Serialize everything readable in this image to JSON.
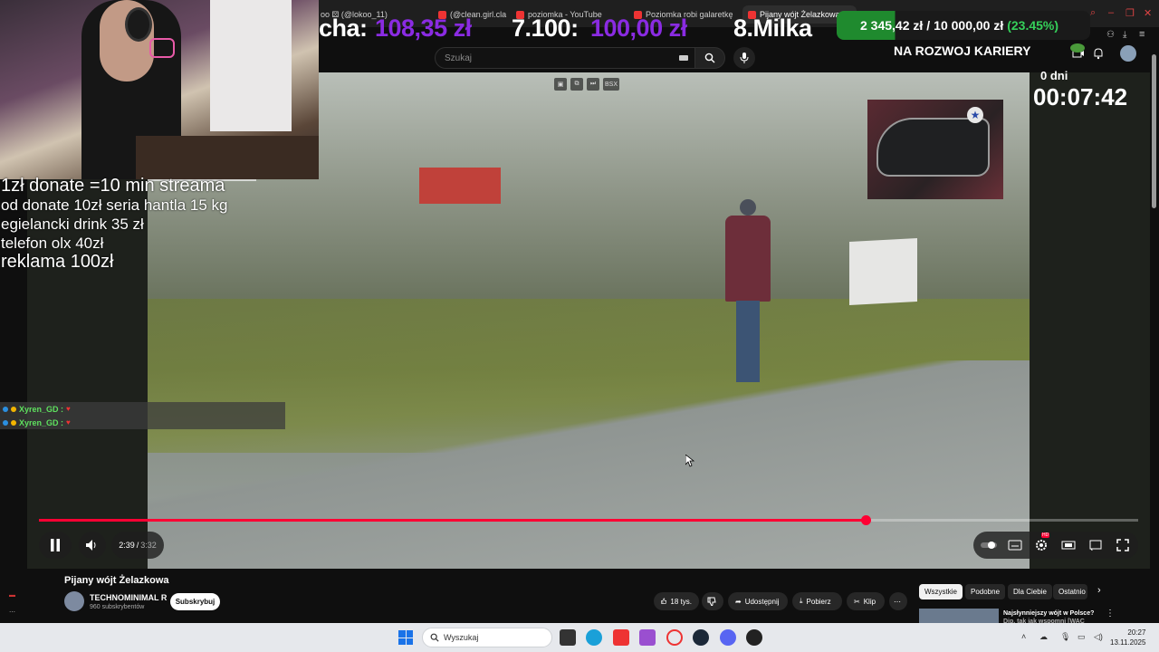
{
  "browser": {
    "tabs": [
      {
        "label": "oo ⚄ (@lokoo_11)"
      },
      {
        "label": "(@clean.girl.cla"
      },
      {
        "label": "poziomka - YouTube"
      },
      {
        "label": "Poziomka robi galaretkę"
      },
      {
        "label": "Pijany wójt Żelazkowa"
      }
    ],
    "new_tab": "+"
  },
  "overlay": {
    "cha_label": "cha:",
    "cha_value": "108,35 zł",
    "second_label": "7.100:",
    "second_value": "100,00 zł",
    "third_label": "8.Milka",
    "goal_current": "2 345,42 zł",
    "goal_separator": "/",
    "goal_target": "10 000,00 zł",
    "goal_percent": "(23.45%)",
    "goal_subtitle": "NA ROZWOJ KARIERY",
    "timer_days": "0 dni",
    "timer": "00:07:42"
  },
  "youtube": {
    "search_placeholder": "Szukaj",
    "video_title": "Pijany wójt Żelazkowa",
    "channel_name": "TECHNOMINIMAL R",
    "channel_subs": "960 subskrybentów",
    "subscribe_label": "Subskrybuj",
    "likes": "18 tys.",
    "share_label": "Udostępnij",
    "download_label": "Pobierz",
    "clip_label": "Klip",
    "time_current": "2:39",
    "time_sep": "/",
    "time_total": "3:32",
    "progress_fraction": 0.752,
    "chips": [
      "Wszystkie",
      "Podobne",
      "Dla Ciebie",
      "Ostatnio"
    ],
    "rec_title_line1": "Najsłynniejszy wójt w Polsce?",
    "rec_title_line2": "Dip, tak jak wspomni [WAC"
  },
  "stream": {
    "donate_lines": [
      "1zł donate =10 min streama",
      "od donate 10zł seria hantla 15 kg",
      "egielancki drink 35 zł",
      "telefon olx 40zł",
      "reklama 100zł"
    ],
    "chat": [
      {
        "user": "Xyren_GD :",
        "msg": "♥"
      },
      {
        "user": "Xyren_GD :",
        "msg": "♥"
      }
    ]
  },
  "taskbar": {
    "search_placeholder": "Wyszukaj",
    "time": "20:27",
    "date": "13.11.2025"
  },
  "colors": {
    "accent": "#ff0033",
    "overlay_purple": "#8a2be2",
    "goal_green": "#35d05a"
  }
}
